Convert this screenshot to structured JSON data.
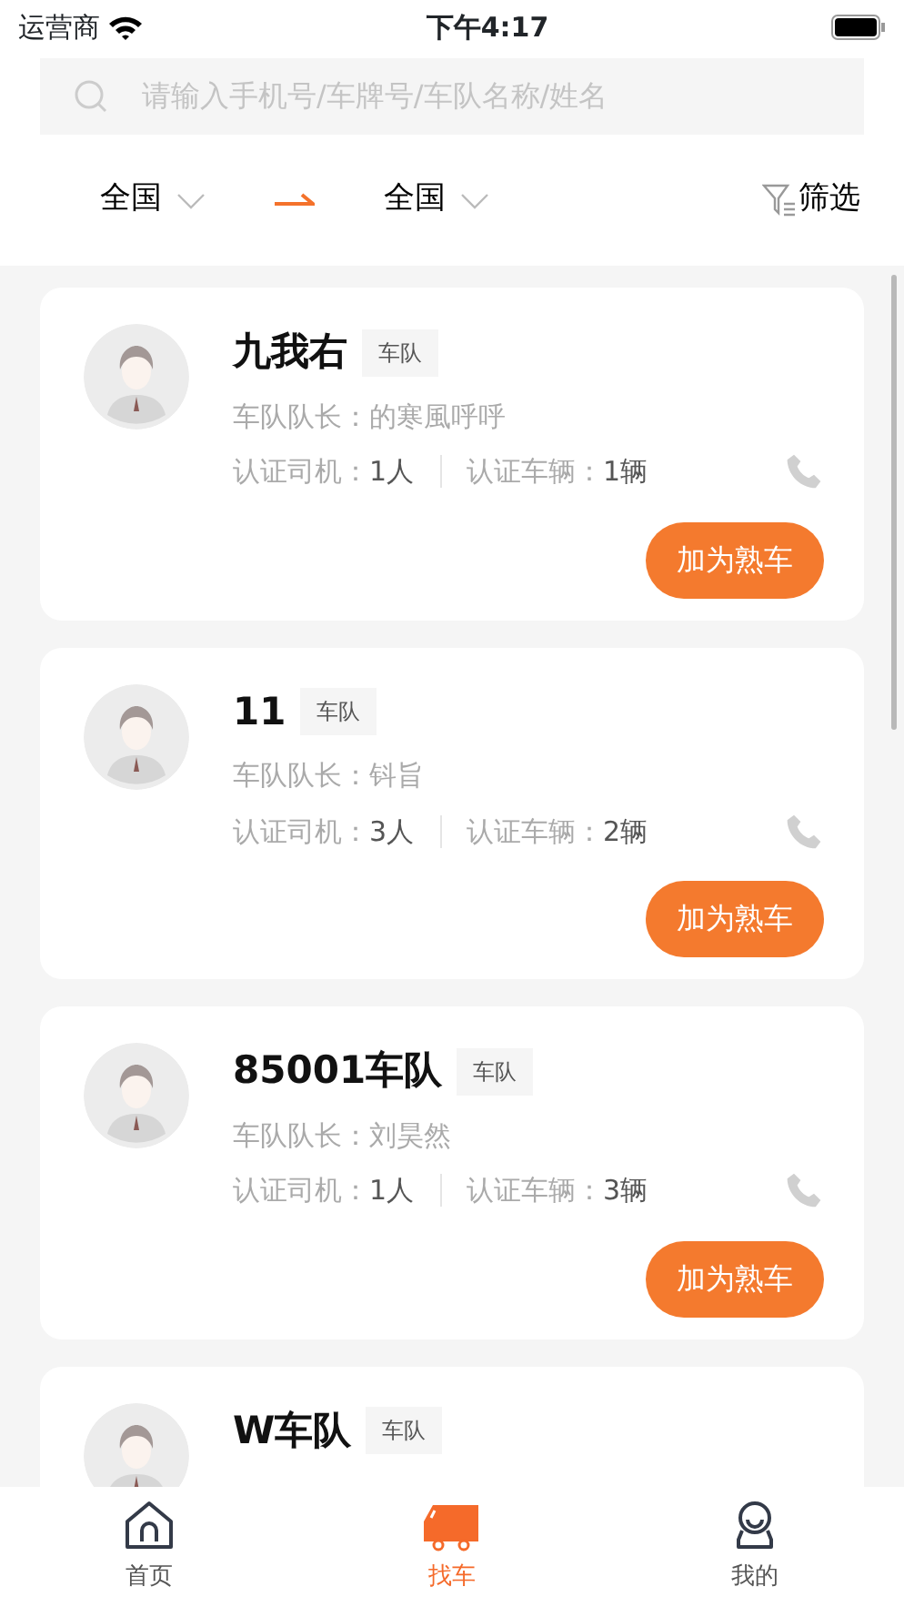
{
  "status_bar": {
    "carrier": "运营商",
    "time": "下午4:17"
  },
  "search": {
    "placeholder": "请输入手机号/车牌号/车队名称/姓名"
  },
  "filters": {
    "from": "全国",
    "to": "全国",
    "filter_label": "筛选"
  },
  "fleets": [
    {
      "name": "九我右",
      "tag": "车队",
      "leader_label": "车队队长：",
      "leader": "的寒風呼呼",
      "drivers_label": "认证司机：",
      "drivers": "1人",
      "vehicles_label": "认证车辆：",
      "vehicles": "1辆",
      "button": "加为熟车"
    },
    {
      "name": "11",
      "tag": "车队",
      "leader_label": "车队队长：",
      "leader": "钭旨",
      "drivers_label": "认证司机：",
      "drivers": "3人",
      "vehicles_label": "认证车辆：",
      "vehicles": "2辆",
      "button": "加为熟车"
    },
    {
      "name": "85001车队",
      "tag": "车队",
      "leader_label": "车队队长：",
      "leader": "刘昊然",
      "drivers_label": "认证司机：",
      "drivers": "1人",
      "vehicles_label": "认证车辆：",
      "vehicles": "3辆",
      "button": "加为熟车"
    },
    {
      "name": "W车队",
      "tag": "车队"
    }
  ],
  "tab_bar": [
    {
      "kind": "home",
      "label": "首页",
      "selected": false
    },
    {
      "kind": "truck",
      "label": "找车",
      "selected": true
    },
    {
      "kind": "profile",
      "label": "我的",
      "selected": false
    }
  ]
}
